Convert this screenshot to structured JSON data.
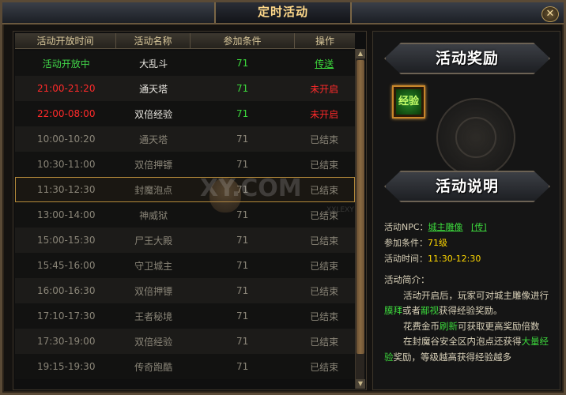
{
  "window": {
    "title": "定时活动",
    "close_label": "✕"
  },
  "table": {
    "headers": [
      "活动开放时间",
      "活动名称",
      "参加条件",
      "操作"
    ],
    "rows": [
      {
        "time": "活动开放中",
        "name": "大乱斗",
        "cond": "71",
        "op": "传送",
        "state": "open"
      },
      {
        "time": "21:00-21:20",
        "name": "通天塔",
        "cond": "71",
        "op": "未开启",
        "state": "pending"
      },
      {
        "time": "22:00-08:00",
        "name": "双倍经验",
        "cond": "71",
        "op": "未开启",
        "state": "pending"
      },
      {
        "time": "10:00-10:20",
        "name": "通天塔",
        "cond": "71",
        "op": "已结束",
        "state": "ended"
      },
      {
        "time": "10:30-11:00",
        "name": "双倍押镖",
        "cond": "71",
        "op": "已结束",
        "state": "ended"
      },
      {
        "time": "11:30-12:30",
        "name": "封魔泡点",
        "cond": "71",
        "op": "已结束",
        "state": "ended",
        "selected": true
      },
      {
        "time": "13:00-14:00",
        "name": "神威狱",
        "cond": "71",
        "op": "已结束",
        "state": "ended"
      },
      {
        "time": "15:00-15:30",
        "name": "尸王大殿",
        "cond": "71",
        "op": "已结束",
        "state": "ended"
      },
      {
        "time": "15:45-16:00",
        "name": "守卫城主",
        "cond": "71",
        "op": "已结束",
        "state": "ended"
      },
      {
        "time": "16:00-16:30",
        "name": "双倍押镖",
        "cond": "71",
        "op": "已结束",
        "state": "ended"
      },
      {
        "time": "17:10-17:30",
        "name": "王者秘境",
        "cond": "71",
        "op": "已结束",
        "state": "ended"
      },
      {
        "time": "17:30-19:00",
        "name": "双倍经验",
        "cond": "71",
        "op": "已结束",
        "state": "ended"
      },
      {
        "time": "19:15-19:30",
        "name": "传奇跑酷",
        "cond": "71",
        "op": "已结束",
        "state": "ended"
      }
    ]
  },
  "reward": {
    "banner": "活动奖励",
    "item_label": "经验"
  },
  "details": {
    "banner": "活动说明",
    "npc_label": "活动NPC：",
    "npc_value": "城主雕像",
    "npc_teleport": "[传]",
    "cond_label": "参加条件：",
    "cond_value": "71级",
    "time_label": "活动时间：",
    "time_value": "11:30-12:30",
    "intro_label": "活动简介：",
    "line1a": "活动开启后，玩家可对城主雕像进行",
    "line1b_g1": "膜拜",
    "line1b_mid": "或者",
    "line1b_g2": "鄙视",
    "line1b_end": "获得经验奖励。",
    "line2a": "花费金币",
    "line2_g": "刷新",
    "line2b": "可获取更高奖励倍数",
    "line3a": "在封魔谷安全区内泡点还获得",
    "line3_g": "大量经",
    "line3b_g": "验",
    "line3b": "奖励，等级越高获得经验越多"
  },
  "watermark": {
    "main": "XY.COM",
    "sub": "XXLEXY"
  },
  "colors": {
    "open": "#42d84a",
    "pending": "#ff2a2a",
    "ended": "#8a8578",
    "accent": "#ffd98a"
  }
}
